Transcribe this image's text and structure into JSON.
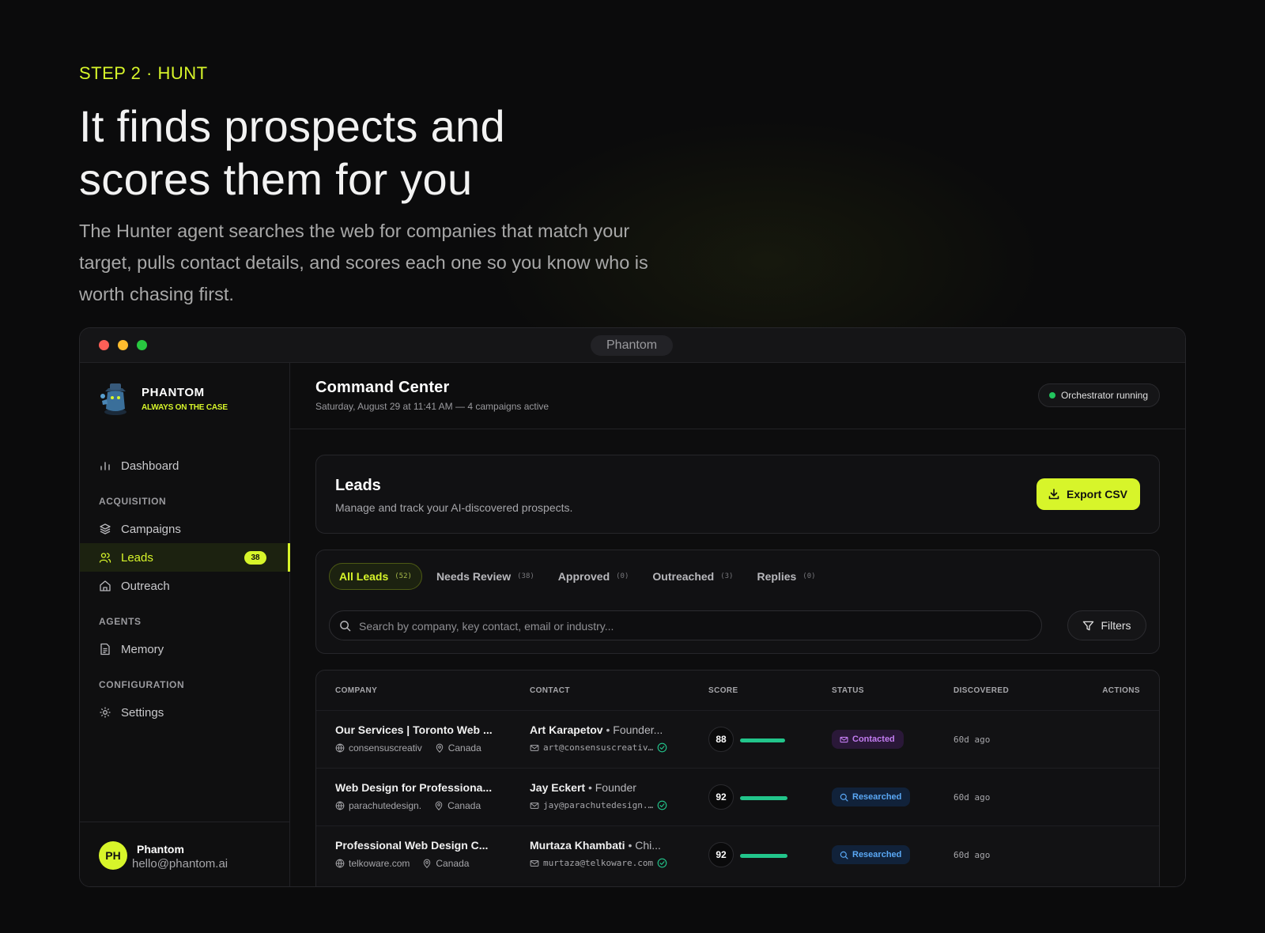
{
  "hero": {
    "eyebrow": "STEP 2 · HUNT",
    "title_line1": "It finds prospects and",
    "title_line2": "scores them for you",
    "desc": "The Hunter agent searches the web for companies that match your target, pulls contact details, and scores each one so you know who is worth chasing first."
  },
  "window": {
    "title": "Phantom"
  },
  "sidebar": {
    "brand_name": "PHANTOM",
    "brand_tagline": "ALWAYS ON THE CASE",
    "dashboard": "Dashboard",
    "sections": {
      "acquisition": "ACQUISITION",
      "agents": "AGENTS",
      "configuration": "CONFIGURATION"
    },
    "items": {
      "campaigns": "Campaigns",
      "leads": "Leads",
      "leads_badge": "38",
      "outreach": "Outreach",
      "memory": "Memory",
      "settings": "Settings"
    },
    "user": {
      "initials": "PH",
      "name": "Phantom",
      "email": "hello@phantom.ai"
    }
  },
  "header": {
    "title": "Command Center",
    "subtitle": "Saturday, August 29 at 11:41 AM — 4 campaigns active",
    "status": "Orchestrator running"
  },
  "leads_card": {
    "title": "Leads",
    "subtitle": "Manage and track your AI-discovered prospects.",
    "export": "Export CSV"
  },
  "tabs": [
    {
      "label": "All Leads",
      "count": "(52)"
    },
    {
      "label": "Needs Review",
      "count": "(38)"
    },
    {
      "label": "Approved",
      "count": "(0)"
    },
    {
      "label": "Outreached",
      "count": "(3)"
    },
    {
      "label": "Replies",
      "count": "(0)"
    }
  ],
  "search": {
    "placeholder": "Search by company, key contact, email or industry..."
  },
  "filters": "Filters",
  "table": {
    "columns": [
      "COMPANY",
      "CONTACT",
      "SCORE",
      "STATUS",
      "DISCOVERED",
      "ACTIONS"
    ],
    "rows": [
      {
        "company": "Our Services | Toronto Web ...",
        "domain": "consensuscreativ",
        "country": "Canada",
        "contact": "Art Karapetov",
        "role": "• Founder...",
        "email": "art@consensuscreativ…",
        "score": 88,
        "status": "Contacted",
        "status_kind": "contacted",
        "discovered": "60d ago"
      },
      {
        "company": "Web Design for Professiona...",
        "domain": "parachutedesign.",
        "country": "Canada",
        "contact": "Jay Eckert",
        "role": "• Founder",
        "email": "jay@parachutedesign.…",
        "score": 92,
        "status": "Researched",
        "status_kind": "researched",
        "discovered": "60d ago"
      },
      {
        "company": "Professional Web Design C...",
        "domain": "telkoware.com",
        "country": "Canada",
        "contact": "Murtaza Khambati",
        "role": "• Chi...",
        "email": "murtaza@telkoware.com",
        "score": 92,
        "status": "Researched",
        "status_kind": "researched",
        "discovered": "60d ago"
      }
    ]
  },
  "colors": {
    "accent": "#d7f52a",
    "score_bar": "#22c58b",
    "contacted": "#c27cf0",
    "researched": "#5aa8f5",
    "online": "#22c55e"
  }
}
